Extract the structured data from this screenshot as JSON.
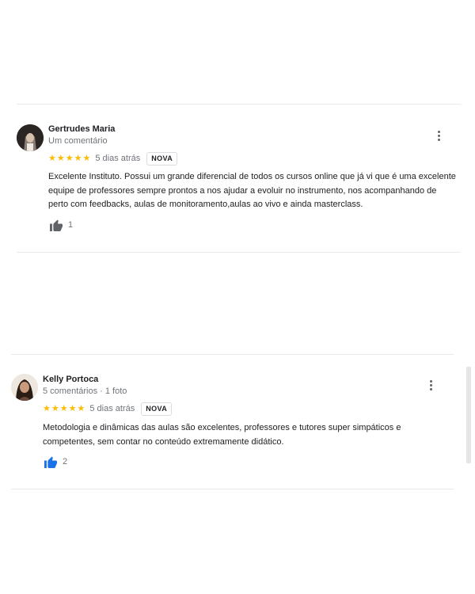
{
  "reviews": [
    {
      "name": "Gertrudes Maria",
      "meta": "Um comentário",
      "rating": 5,
      "date": "5 dias atrás",
      "badge": "NOVA",
      "text": "Excelente Instituto. Possui um grande diferencial de todos os cursos online que já vi que é uma excelente equipe de professores sempre prontos a nos ajudar a evoluir no instrumento, nos acompanhando de perto com feedbacks, aulas de monitoramento,aulas ao vivo e ainda masterclass.",
      "likes": "1",
      "like_color": "#5f6368",
      "avatar_icon": "avatar-photo-icon"
    },
    {
      "name": "Kelly Portoca",
      "meta": "5 comentários · 1 foto",
      "rating": 5,
      "date": "5 dias atrás",
      "badge": "NOVA",
      "text": "Metodologia e dinâmicas das aulas são excelentes, professores e tutores super simpáticos e competentes, sem contar no conteúdo extremamente didático.",
      "likes": "2",
      "like_color": "#1a73e8",
      "avatar_icon": "avatar-photo-icon"
    }
  ],
  "colors": {
    "star": "#fbbc04",
    "divider": "#e8eaed",
    "meta_text": "#70757a"
  }
}
